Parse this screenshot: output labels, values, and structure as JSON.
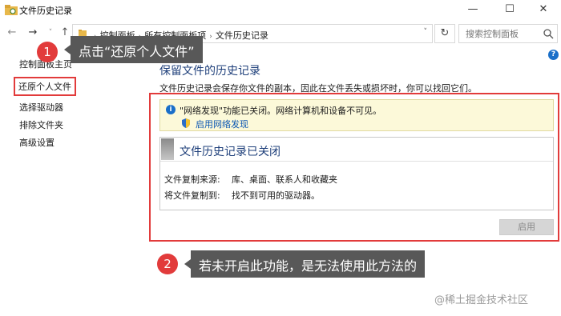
{
  "window": {
    "title": "文件历史记录",
    "min_glyph": "—",
    "max_glyph": "☐",
    "close_glyph": "✕"
  },
  "nav": {
    "back": "←",
    "forward": "→",
    "recent": "˅",
    "up": "↑",
    "breadcrumbs": [
      "控制面板",
      "所有控制面板项",
      "文件历史记录"
    ],
    "dropdown": "˅",
    "refresh": "↻",
    "search_placeholder": "搜索控制面板"
  },
  "help": "?",
  "sidebar": {
    "home": "控制面板主页",
    "items": [
      {
        "label": "还原个人文件",
        "active": true
      },
      {
        "label": "选择驱动器",
        "active": false
      },
      {
        "label": "排除文件夹",
        "active": false
      },
      {
        "label": "高级设置",
        "active": false
      }
    ]
  },
  "main": {
    "title": "保留文件的历史记录",
    "description": "文件历史记录会保存你文件的副本，因此在文件丢失或损坏时，你可以找回它们。",
    "info": {
      "icon": "i",
      "message": "\"网络发现\"功能已关闭。网络计算机和设备不可见。",
      "link": "启用网络发现"
    },
    "status": {
      "title": "文件历史记录已关闭",
      "source_label": "文件复制来源:",
      "source_value": "库、桌面、联系人和收藏夹",
      "dest_label": "将文件复制到:",
      "dest_value": "找不到可用的驱动器。"
    },
    "enable_button": "启用"
  },
  "callouts": [
    {
      "number": "1",
      "text": "点击“还原个人文件”"
    },
    {
      "number": "2",
      "text": "若未开启此功能，是无法使用此方法的"
    }
  ],
  "watermark": "@稀土掘金技术社区",
  "colors": {
    "accent_red": "#e23b3b",
    "link_blue": "#0c57b3",
    "title_blue": "#1e3f7a",
    "info_bg": "#fcf9d9",
    "callout_bg": "#585858"
  }
}
